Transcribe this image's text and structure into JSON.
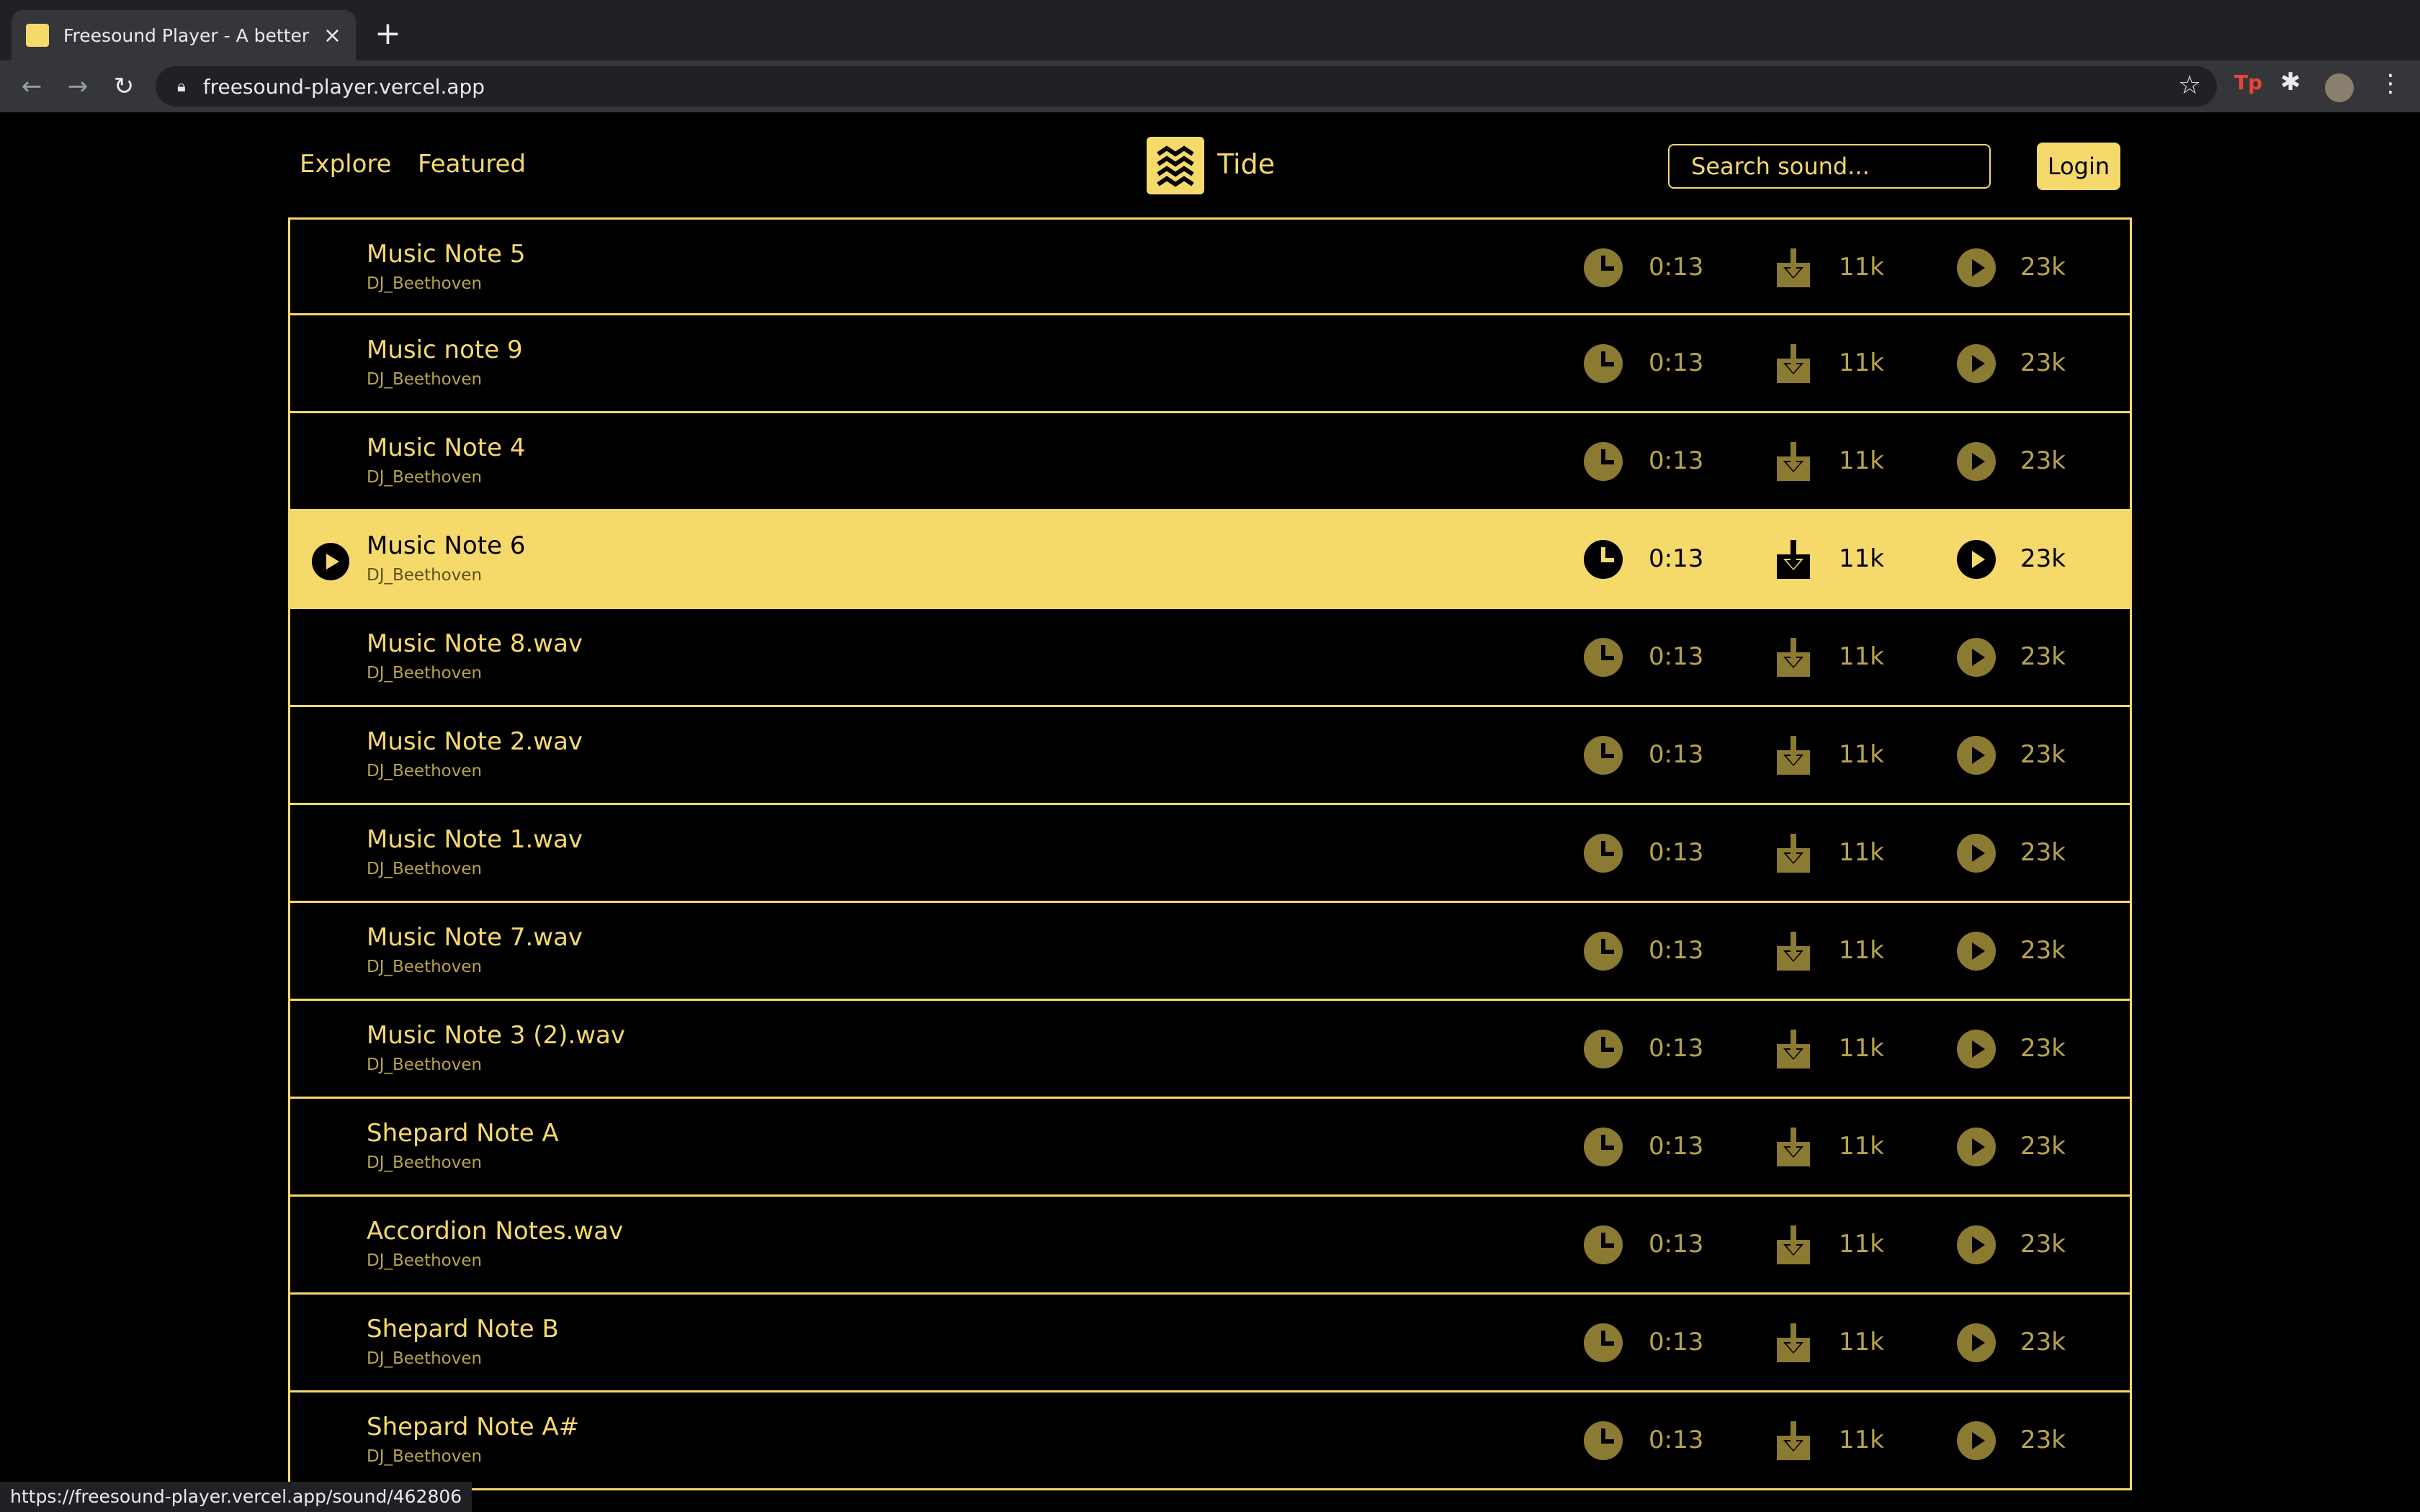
{
  "browser": {
    "tab_title": "Freesound Player - A better Fre",
    "new_tab": "+",
    "close": "×",
    "url": "freesound-player.vercel.app",
    "ext_label": "Tp",
    "status_url": "https://freesound-player.vercel.app/sound/462806"
  },
  "header": {
    "nav": [
      "Explore",
      "Featured"
    ],
    "logo_text": "Tide",
    "search_placeholder": "Search sound...",
    "login_label": "Login"
  },
  "colors": {
    "accent": "#f6d96b",
    "background": "#000000",
    "muted": "#8b7a31"
  },
  "sounds": [
    {
      "name": "Music Note 5",
      "author": "DJ_Beethoven",
      "duration": "0:13",
      "downloads": "11k",
      "plays": "23k"
    },
    {
      "name": "Music note 9",
      "author": "DJ_Beethoven",
      "duration": "0:13",
      "downloads": "11k",
      "plays": "23k"
    },
    {
      "name": "Music Note 4",
      "author": "DJ_Beethoven",
      "duration": "0:13",
      "downloads": "11k",
      "plays": "23k"
    },
    {
      "name": "Music Note 6",
      "author": "DJ_Beethoven",
      "duration": "0:13",
      "downloads": "11k",
      "plays": "23k",
      "active": true
    },
    {
      "name": "Music Note 8.wav",
      "author": "DJ_Beethoven",
      "duration": "0:13",
      "downloads": "11k",
      "plays": "23k"
    },
    {
      "name": "Music Note 2.wav",
      "author": "DJ_Beethoven",
      "duration": "0:13",
      "downloads": "11k",
      "plays": "23k"
    },
    {
      "name": "Music Note 1.wav",
      "author": "DJ_Beethoven",
      "duration": "0:13",
      "downloads": "11k",
      "plays": "23k"
    },
    {
      "name": "Music Note 7.wav",
      "author": "DJ_Beethoven",
      "duration": "0:13",
      "downloads": "11k",
      "plays": "23k"
    },
    {
      "name": "Music Note 3 (2).wav",
      "author": "DJ_Beethoven",
      "duration": "0:13",
      "downloads": "11k",
      "plays": "23k"
    },
    {
      "name": "Shepard Note A",
      "author": "DJ_Beethoven",
      "duration": "0:13",
      "downloads": "11k",
      "plays": "23k"
    },
    {
      "name": "Accordion Notes.wav",
      "author": "DJ_Beethoven",
      "duration": "0:13",
      "downloads": "11k",
      "plays": "23k"
    },
    {
      "name": "Shepard Note B",
      "author": "DJ_Beethoven",
      "duration": "0:13",
      "downloads": "11k",
      "plays": "23k"
    },
    {
      "name": "Shepard Note A#",
      "author": "DJ_Beethoven",
      "duration": "0:13",
      "downloads": "11k",
      "plays": "23k"
    }
  ]
}
